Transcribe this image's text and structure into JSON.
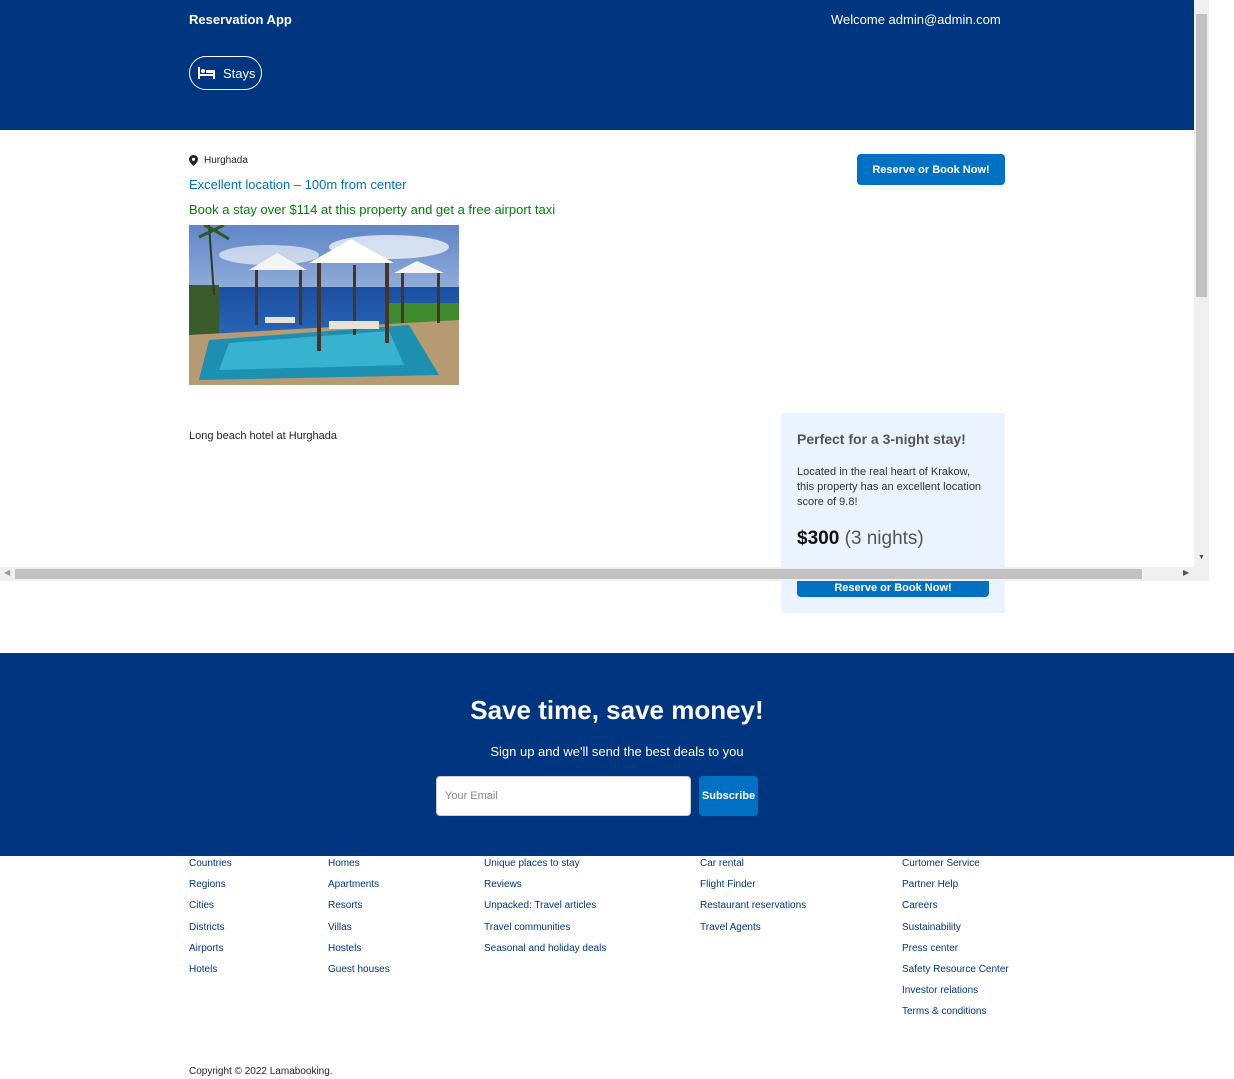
{
  "header": {
    "brand": "Reservation App",
    "welcome": "Welcome admin@admin.com",
    "stays_label": "Stays"
  },
  "hotel": {
    "location": "Hurghada",
    "distance": "Excellent location – 100m from center",
    "offer": "Book a stay over $114 at this property and get a free airport taxi",
    "reserve_label": "Reserve or Book Now!",
    "description": "Long beach hotel at Hurghada"
  },
  "price_box": {
    "title": "Perfect for a 3-night stay!",
    "text": "Located in the real heart of Krakow, this property has an excellent location score of 9.8!",
    "price": "$300",
    "nights": "(3 nights)",
    "reserve_label": "Reserve or Book Now!"
  },
  "newsletter": {
    "title": "Save time, save money!",
    "subtitle": "Sign up and we'll send the best deals to you",
    "email_placeholder": "Your Email",
    "subscribe_label": "Subscribe"
  },
  "footer": {
    "columns": [
      [
        "Countries",
        "Regions",
        "Cities",
        "Districts",
        "Airports",
        "Hotels"
      ],
      [
        "Homes",
        "Apartments",
        "Resorts",
        "Villas",
        "Hostels",
        "Guest houses"
      ],
      [
        "Unique places to stay",
        "Reviews",
        "Unpacked: Travel articles",
        "Travel communities",
        "Seasonal and holiday deals"
      ],
      [
        "Car rental",
        "Flight Finder",
        "Restaurant reservations",
        "Travel Agents"
      ],
      [
        "Curtomer Service",
        "Partner Help",
        "Careers",
        "Sustainability",
        "Press center",
        "Safety Resource Center",
        "Investor relations",
        "Terms & conditions"
      ]
    ],
    "copyright": "Copyright © 2022 Lamabooking."
  },
  "colors": {
    "brand_blue": "#003580",
    "button_blue": "#0071c2",
    "offer_green": "#008009",
    "price_box_bg": "#ebf3ff"
  },
  "icons": [
    "bed-icon",
    "location-pin-icon"
  ]
}
